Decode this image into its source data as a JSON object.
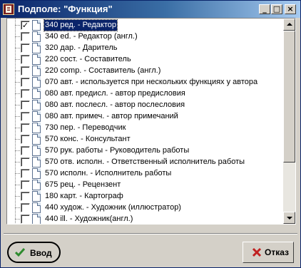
{
  "window": {
    "title": "Подполе: \"Функция\"",
    "controls": {
      "minimize": "_",
      "maximize": "□",
      "close": "×"
    }
  },
  "list": {
    "items": [
      {
        "label": "340 ред. - Редактор",
        "checked": true,
        "selected": true
      },
      {
        "label": "340 ed. - Редактор (англ.)",
        "checked": false
      },
      {
        "label": "320 дар. - Даритель",
        "checked": false
      },
      {
        "label": "220 сост. - Составитель",
        "checked": false
      },
      {
        "label": "220 comp. - Составитель (англ.)",
        "checked": false
      },
      {
        "label": "070 авт. - используется при нескольких функциях у автора",
        "checked": false
      },
      {
        "label": "080 авт. предисл. - автор предисловия",
        "checked": false
      },
      {
        "label": "080 авт. послесл. - автор послесловия",
        "checked": false
      },
      {
        "label": "080 авт. примеч. - автор примечаний",
        "checked": false
      },
      {
        "label": "730 пер. - Переводчик",
        "checked": false
      },
      {
        "label": "570 конс. - Консультант",
        "checked": false
      },
      {
        "label": "570 рук. работы - Руководитель работы",
        "checked": false
      },
      {
        "label": "570 отв. исполн. - Ответственный исполнитель работы",
        "checked": false
      },
      {
        "label": "570 исполн. - Исполнитель работы",
        "checked": false
      },
      {
        "label": "675 рец. - Рецензент",
        "checked": false
      },
      {
        "label": "180 карт. - Картограф",
        "checked": false
      },
      {
        "label": "440 худож. - Художник (иллюстратор)",
        "checked": false
      },
      {
        "label": "440 ill. - Художник(англ.)",
        "checked": false
      }
    ]
  },
  "buttons": {
    "ok_label": "Ввод",
    "cancel_label": "Отказ"
  },
  "colors": {
    "titlebar_start": "#0a246a",
    "titlebar_end": "#a6caf0",
    "selection": "#0a246a",
    "ok_icon": "#2e8b2e",
    "cancel_icon": "#c02020"
  },
  "icons": [
    "app-icon",
    "document-icon",
    "check-icon",
    "x-icon",
    "scroll-up-arrow-icon",
    "scroll-down-arrow-icon"
  ]
}
